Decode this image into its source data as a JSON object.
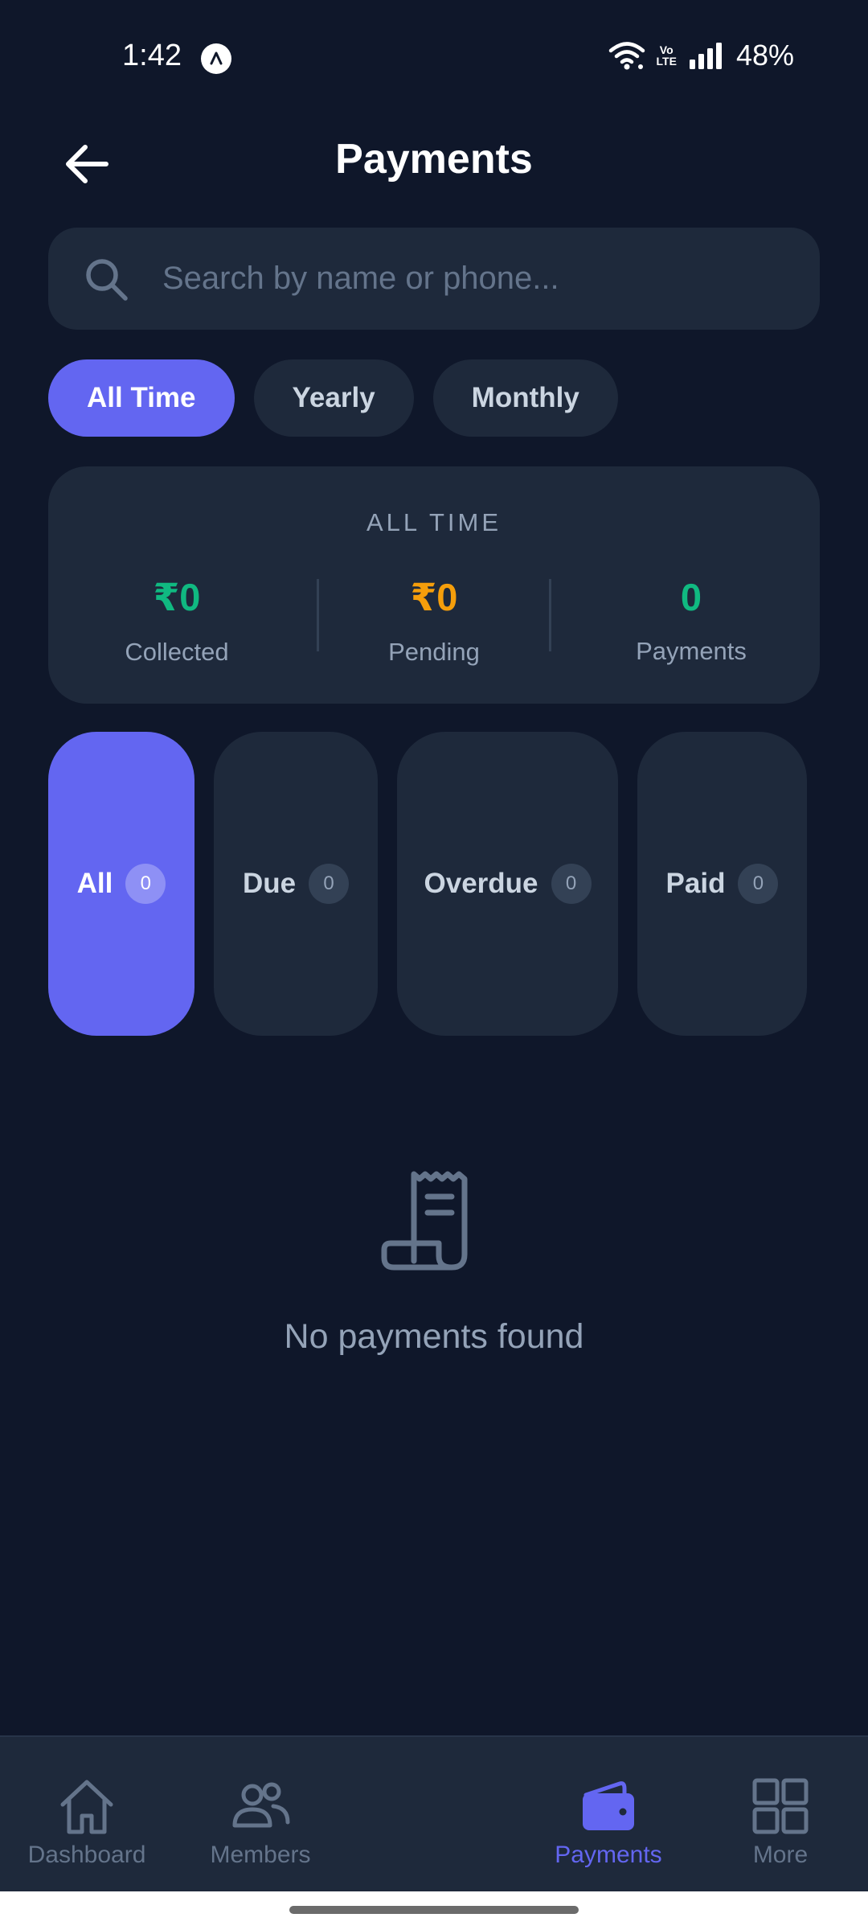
{
  "status_bar": {
    "time": "1:42",
    "battery": "48%",
    "volte_top": "Vo",
    "volte_bottom": "LTE"
  },
  "header": {
    "title": "Payments",
    "back_icon": "arrow-left-icon"
  },
  "search": {
    "placeholder": "Search by name or phone...",
    "value": "",
    "icon": "search-icon"
  },
  "period_chips": {
    "items": [
      {
        "label": "All Time",
        "active": true
      },
      {
        "label": "Yearly",
        "active": false
      },
      {
        "label": "Monthly",
        "active": false
      }
    ]
  },
  "summary": {
    "heading": "ALL TIME",
    "collected": {
      "value": "₹0",
      "label": "Collected",
      "color": "#10b981"
    },
    "pending": {
      "value": "₹0",
      "label": "Pending",
      "color": "#f59e0b"
    },
    "payments": {
      "value": "0",
      "label": "Payments",
      "color": "#10b981"
    }
  },
  "status_tabs": {
    "items": [
      {
        "label": "All",
        "count": "0",
        "active": true
      },
      {
        "label": "Due",
        "count": "0",
        "active": false
      },
      {
        "label": "Overdue",
        "count": "0",
        "active": false
      },
      {
        "label": "Paid",
        "count": "0",
        "active": false
      }
    ]
  },
  "empty_state": {
    "icon": "receipt-icon",
    "message": "No payments found"
  },
  "bottom_nav": {
    "items": [
      {
        "label": "Dashboard",
        "icon": "home-icon",
        "active": false
      },
      {
        "label": "Members",
        "icon": "users-icon",
        "active": false
      },
      {
        "label": "Payments",
        "icon": "wallet-icon",
        "active": true
      },
      {
        "label": "More",
        "icon": "grid-icon",
        "active": false
      }
    ]
  },
  "colors": {
    "accent": "#6366f1",
    "background": "#0f172a",
    "surface": "#1e293b",
    "success": "#10b981",
    "warning": "#f59e0b"
  }
}
